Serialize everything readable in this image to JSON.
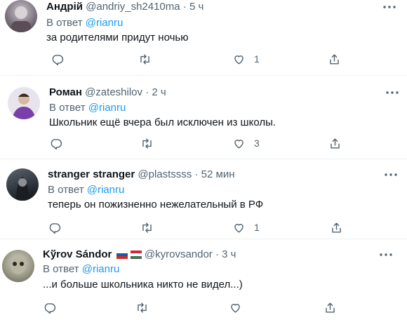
{
  "reply_prefix": "В ответ",
  "mention": "@rianru",
  "colors": {
    "accent": "#1d9bf0",
    "secondary_text": "#536471",
    "primary_text": "#0f1419",
    "separator": "#eff3f4"
  },
  "tweets": [
    {
      "name": "Андрій",
      "handle": "@andriy_sh2410ma",
      "separator": "·",
      "time": "5 ч",
      "text": "за родителями придут ночью",
      "likes": "1",
      "icons": [
        "reply-icon",
        "retweet-icon",
        "like-icon",
        "share-icon",
        "more-icon"
      ]
    },
    {
      "name": "Роман",
      "handle": "@zateshilov",
      "separator": "·",
      "time": "2 ч",
      "text": "Школьник ещё вчера был исключен из школы.",
      "likes": "3",
      "icons": [
        "reply-icon",
        "retweet-icon",
        "like-icon",
        "share-icon",
        "more-icon"
      ]
    },
    {
      "name": "stranger stranger",
      "handle": "@plastssss",
      "separator": "·",
      "time": "52 мин",
      "text": "теперь он пожизненно нежелательный в РФ",
      "likes": "1",
      "icons": [
        "reply-icon",
        "retweet-icon",
        "like-icon",
        "share-icon",
        "more-icon"
      ]
    },
    {
      "name": "Kўrov Sándor",
      "name_flags": [
        "flag-russia-icon",
        "flag-hungary-icon"
      ],
      "handle": "@kyrovsandor",
      "separator": "·",
      "time": "3 ч",
      "text": "...и больше школьника никто не видел...)",
      "likes": "",
      "icons": [
        "reply-icon",
        "retweet-icon",
        "like-icon",
        "share-icon",
        "more-icon"
      ]
    }
  ]
}
